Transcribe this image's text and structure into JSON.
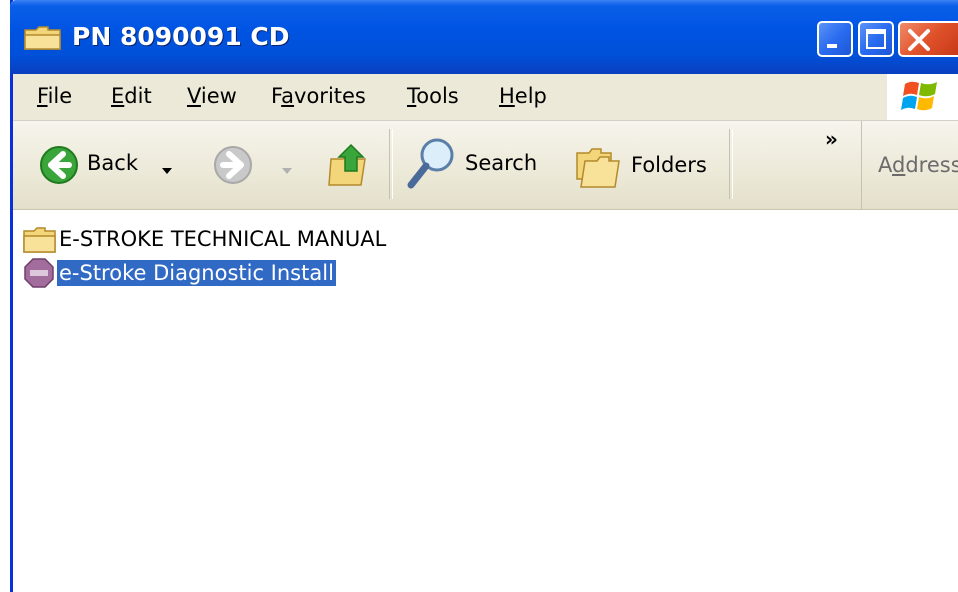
{
  "window": {
    "title": "PN 8090091 CD",
    "title_icon": "folder-icon"
  },
  "menubar": {
    "items": [
      {
        "mnemonic": "F",
        "rest": "ile"
      },
      {
        "mnemonic": "E",
        "rest": "dit"
      },
      {
        "mnemonic": "V",
        "rest": "iew"
      },
      {
        "pre": "F",
        "mnemonic": "a",
        "rest": "vorites"
      },
      {
        "mnemonic": "T",
        "rest": "ools"
      },
      {
        "mnemonic": "H",
        "rest": "elp"
      }
    ]
  },
  "toolbar": {
    "back_label": "Back",
    "search_label": "Search",
    "folders_label": "Folders",
    "overflow_label": "»",
    "address_pre": "A",
    "address_mnemonic": "d",
    "address_rest": "dress"
  },
  "files": [
    {
      "name": "E-STROKE TECHNICAL MANUAL",
      "icon": "folder-icon",
      "selected": false
    },
    {
      "name": "e-Stroke Diagnostic Install",
      "icon": "installer-icon",
      "selected": true
    }
  ],
  "colors": {
    "titlebar": "#0054e3",
    "selection": "#316ac5",
    "chrome": "#ece9d8"
  }
}
